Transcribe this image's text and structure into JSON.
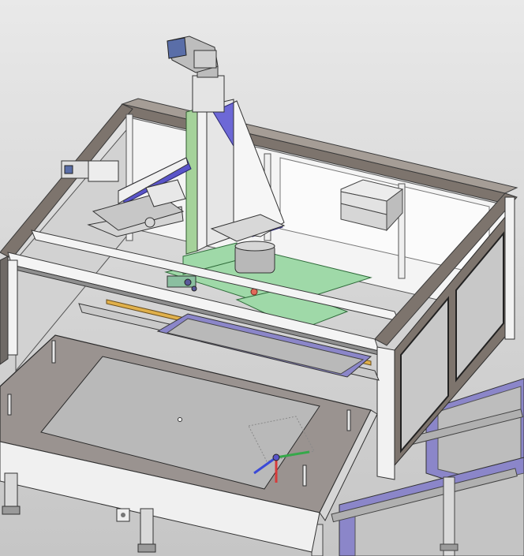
{
  "viewport": {
    "background_top": "#e9e9e9",
    "background_bottom": "#c6c6c6"
  },
  "colors": {
    "frame_dark": "#7d746d",
    "frame_light": "#f1f1f1",
    "frame_edge": "#3a3a3a",
    "panel_glass": "#c8c8c8",
    "accent_blue": "#5a55c9",
    "accent_green": "#9fd9a8",
    "tray": "#9a9390",
    "plate": "#b9b9b9",
    "conveyor": "#8b86c9",
    "steel": "#a8a8a8"
  },
  "icons": {
    "triad": "coordinate-triad-icon"
  }
}
